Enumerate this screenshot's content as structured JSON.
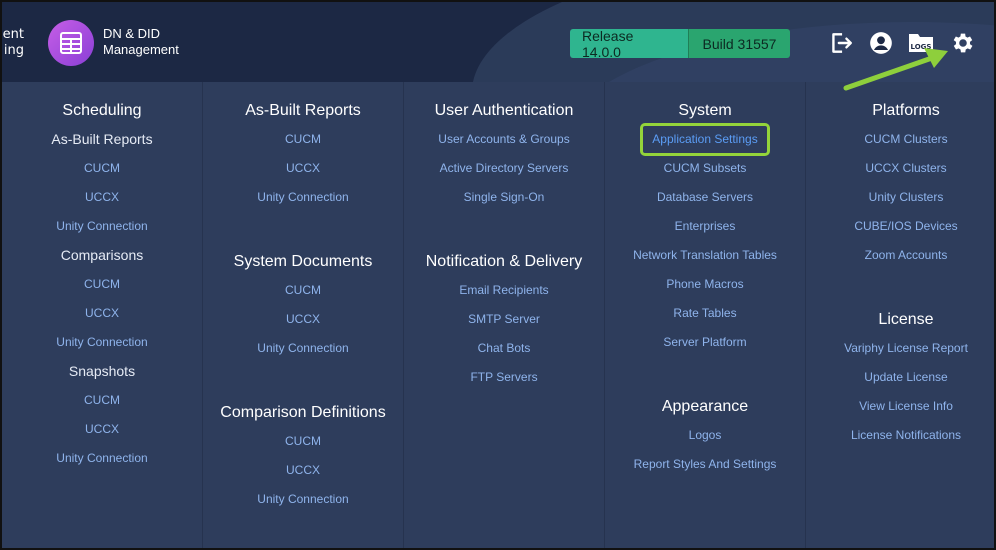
{
  "header": {
    "left_title": [
      "ent",
      "ing"
    ],
    "app_title": [
      "DN & DID",
      "Management"
    ],
    "release": "Release 14.0.0",
    "build": "Build 31557",
    "logs_icon_text": "LOGS",
    "icons": [
      "logout-icon",
      "user-circle-icon",
      "logs-folder-icon",
      "gear-icon"
    ]
  },
  "colors": {
    "header_bg": "#1c2844",
    "menu_bg": "#2e3d5c",
    "link": "#8fb4ec",
    "highlight_border": "#93d43a",
    "release_green": "#2fb58f",
    "build_green": "#2aa56f",
    "app_logo": "#b04fe0"
  },
  "columns": [
    {
      "sections": [
        {
          "title": "Scheduling",
          "items": []
        },
        {
          "subtitle": "As-Built Reports",
          "items": [
            "CUCM",
            "UCCX",
            "Unity Connection"
          ]
        },
        {
          "subtitle": "Comparisons",
          "items": [
            "CUCM",
            "UCCX",
            "Unity Connection"
          ]
        },
        {
          "subtitle": "Snapshots",
          "items": [
            "CUCM",
            "UCCX",
            "Unity Connection"
          ]
        }
      ]
    },
    {
      "sections": [
        {
          "title": "As-Built Reports",
          "items": [
            "CUCM",
            "UCCX",
            "Unity Connection"
          ]
        },
        {
          "title": "System Documents",
          "items": [
            "CUCM",
            "UCCX",
            "Unity Connection"
          ]
        },
        {
          "title": "Comparison Definitions",
          "items": [
            "CUCM",
            "UCCX",
            "Unity Connection"
          ]
        }
      ]
    },
    {
      "sections": [
        {
          "title": "User Authentication",
          "items": [
            "User Accounts & Groups",
            "Active Directory Servers",
            "Single Sign-On"
          ]
        },
        {
          "title": "Notification & Delivery",
          "items": [
            "Email Recipients",
            "SMTP Server",
            "Chat Bots",
            "FTP Servers"
          ]
        }
      ]
    },
    {
      "sections": [
        {
          "title": "System",
          "highlight": 0,
          "items": [
            "Application Settings",
            "CUCM Subsets",
            "Database Servers",
            "Enterprises",
            "Network Translation Tables",
            "Phone Macros",
            "Rate Tables",
            "Server Platform"
          ]
        },
        {
          "title": "Appearance",
          "items": [
            "Logos",
            "Report Styles And Settings"
          ]
        }
      ]
    },
    {
      "sections": [
        {
          "title": "Platforms",
          "items": [
            "CUCM Clusters",
            "UCCX Clusters",
            "Unity Clusters",
            "CUBE/IOS Devices",
            "Zoom Accounts"
          ]
        },
        {
          "title": "License",
          "items": [
            "Variphy License Report",
            "Update License",
            "View License Info",
            "License Notifications"
          ]
        }
      ]
    }
  ]
}
